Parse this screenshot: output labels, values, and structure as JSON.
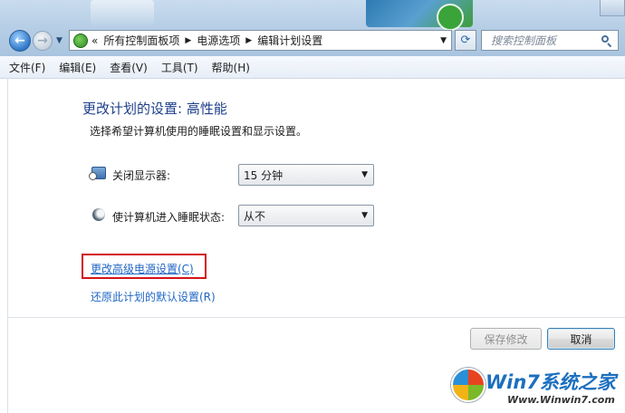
{
  "address_bar": {
    "prefix": "«",
    "crumbs": [
      "所有控制面板项",
      "电源选项",
      "编辑计划设置"
    ]
  },
  "search": {
    "placeholder": "搜索控制面板"
  },
  "menu": [
    "文件(F)",
    "编辑(E)",
    "查看(V)",
    "工具(T)",
    "帮助(H)"
  ],
  "page": {
    "title": "更改计划的设置: 高性能",
    "subtitle": "选择希望计算机使用的睡眠设置和显示设置。"
  },
  "settings": [
    {
      "label": "关闭显示器:",
      "value": "15 分钟",
      "icon": "monitor-clock-icon"
    },
    {
      "label": "使计算机进入睡眠状态:",
      "value": "从不",
      "icon": "sleep-moon-icon"
    }
  ],
  "links": {
    "advanced": "更改高级电源设置(C)",
    "restore": "还原此计划的默认设置(R)"
  },
  "buttons": {
    "save": "保存修改",
    "cancel": "取消"
  },
  "watermark": {
    "title": "Win7系统之家",
    "url": "Www.Winwin7.com"
  },
  "colors": {
    "highlight": "#d4141a",
    "link": "#1f66c4",
    "title": "#1e3f8a"
  }
}
